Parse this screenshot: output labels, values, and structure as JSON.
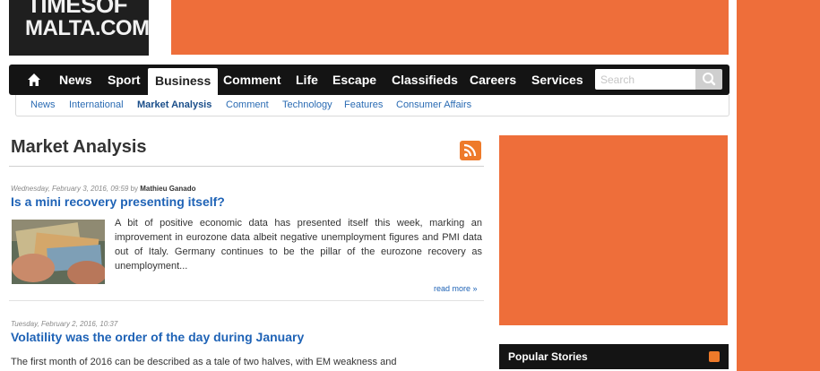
{
  "logo": {
    "line1": "TIMESOF",
    "line2": "MALTA.COM"
  },
  "nav": {
    "items": [
      {
        "label": "News"
      },
      {
        "label": "Sport"
      },
      {
        "label": "Business",
        "active": true
      },
      {
        "label": "Comment"
      },
      {
        "label": "Life"
      },
      {
        "label": "Escape"
      },
      {
        "label": "Classifieds"
      },
      {
        "label": "Careers"
      },
      {
        "label": "Services"
      }
    ],
    "search_placeholder": "Search"
  },
  "subnav": {
    "items": [
      {
        "label": "News"
      },
      {
        "label": "International"
      },
      {
        "label": "Market Analysis",
        "active": true
      },
      {
        "label": "Comment"
      },
      {
        "label": "Technology"
      },
      {
        "label": "Features"
      },
      {
        "label": "Consumer Affairs"
      }
    ]
  },
  "page": {
    "title": "Market Analysis"
  },
  "articles": [
    {
      "date": "Wednesday, February 3, 2016, 09:59",
      "by": "by",
      "author": "Mathieu Ganado",
      "headline": "Is a mini recovery presenting itself?",
      "excerpt": "A bit of positive economic data has presented itself this week, marking an improvement in eurozone data albeit negative unemployment figures and PMI data out of Italy. Germany continues to be the pillar of the eurozone recovery as unemployment...",
      "read_more": "read more »"
    },
    {
      "date": "Tuesday, February 2, 2016, 10:37",
      "headline": "Volatility was the order of the day during January",
      "excerpt": "The first month of 2016 can be described as a tale of two halves, with EM weakness and"
    }
  ],
  "sidebar": {
    "popular_title": "Popular Stories"
  },
  "colors": {
    "accent": "#ee6e3a",
    "nav_bg": "#141414",
    "link": "#1f63b6",
    "rss": "#ee7a2a"
  },
  "icons": {
    "home": "home-icon",
    "search": "search-icon",
    "rss": "rss-icon"
  }
}
